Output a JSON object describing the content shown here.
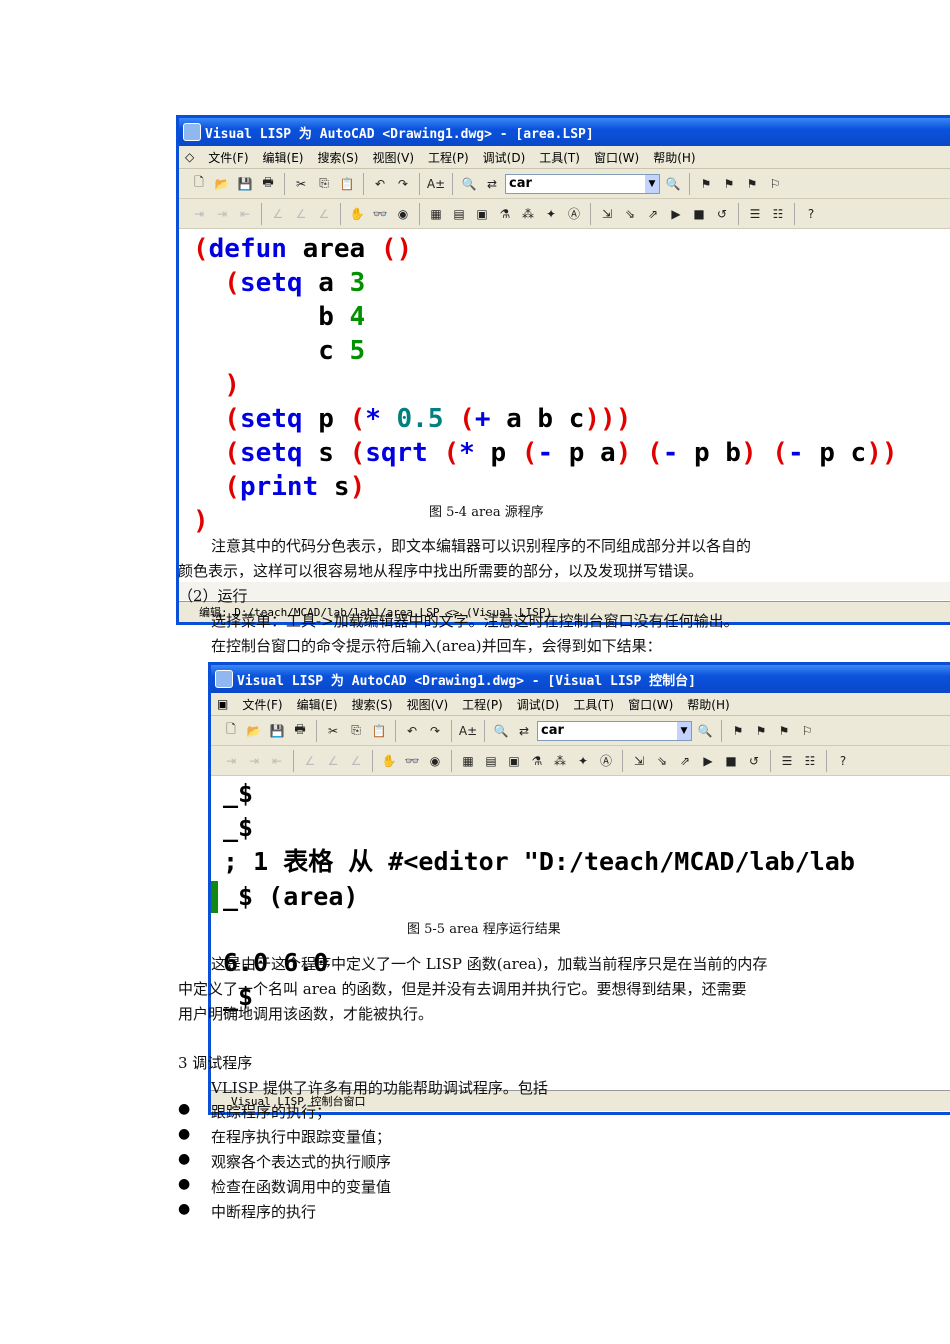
{
  "window1": {
    "title": "Visual LISP 为 AutoCAD <Drawing1.dwg> - [area.LSP]",
    "menu": [
      "文件(F)",
      "编辑(E)",
      "搜索(S)",
      "视图(V)",
      "工程(P)",
      "调试(D)",
      "工具(T)",
      "窗口(W)",
      "帮助(H)"
    ],
    "search_value": "car",
    "code": [
      [
        {
          "t": "(",
          "c": "#e00000"
        },
        {
          "t": "defun",
          "c": "#0000e0"
        },
        {
          "t": " area ",
          "c": "#000"
        },
        {
          "t": "()",
          "c": "#e00000"
        }
      ],
      [
        {
          "t": "  (",
          "c": "#e00000"
        },
        {
          "t": "setq",
          "c": "#0000e0"
        },
        {
          "t": " a ",
          "c": "#000"
        },
        {
          "t": "3",
          "c": "#009000"
        }
      ],
      [
        {
          "t": "        b ",
          "c": "#000"
        },
        {
          "t": "4",
          "c": "#009000"
        }
      ],
      [
        {
          "t": "        c ",
          "c": "#000"
        },
        {
          "t": "5",
          "c": "#009000"
        }
      ],
      [
        {
          "t": "  )",
          "c": "#e00000"
        }
      ],
      [
        {
          "t": "  (",
          "c": "#e00000"
        },
        {
          "t": "setq",
          "c": "#0000e0"
        },
        {
          "t": " p ",
          "c": "#000"
        },
        {
          "t": "(",
          "c": "#e00000"
        },
        {
          "t": "*",
          "c": "#0000e0"
        },
        {
          "t": " ",
          "c": "#000"
        },
        {
          "t": "0.5",
          "c": "#008080"
        },
        {
          "t": " (",
          "c": "#e00000"
        },
        {
          "t": "+",
          "c": "#0000e0"
        },
        {
          "t": " a b c",
          "c": "#000"
        },
        {
          "t": ")))",
          "c": "#e00000"
        }
      ],
      [
        {
          "t": "  (",
          "c": "#e00000"
        },
        {
          "t": "setq",
          "c": "#0000e0"
        },
        {
          "t": " s ",
          "c": "#000"
        },
        {
          "t": "(",
          "c": "#e00000"
        },
        {
          "t": "sqrt",
          "c": "#0000e0"
        },
        {
          "t": " (",
          "c": "#e00000"
        },
        {
          "t": "*",
          "c": "#0000e0"
        },
        {
          "t": " p ",
          "c": "#000"
        },
        {
          "t": "(",
          "c": "#e00000"
        },
        {
          "t": "-",
          "c": "#0000e0"
        },
        {
          "t": " p a",
          "c": "#000"
        },
        {
          "t": ")",
          "c": "#e00000"
        },
        {
          "t": " (",
          "c": "#e00000"
        },
        {
          "t": "-",
          "c": "#0000e0"
        },
        {
          "t": " p b",
          "c": "#000"
        },
        {
          "t": ")",
          "c": "#e00000"
        },
        {
          "t": " (",
          "c": "#e00000"
        },
        {
          "t": "-",
          "c": "#0000e0"
        },
        {
          "t": " p c",
          "c": "#000"
        },
        {
          "t": "))",
          "c": "#e00000"
        }
      ],
      [
        {
          "t": "  (",
          "c": "#e00000"
        },
        {
          "t": "print",
          "c": "#0000e0"
        },
        {
          "t": " s",
          "c": "#000"
        },
        {
          "t": ")",
          "c": "#e00000"
        }
      ],
      [
        {
          "t": ")",
          "c": "#e00000"
        }
      ]
    ],
    "status": "编辑:  D:/teach/MCAD/lab/lab1/area.LSP  <>  (Visual LISP)"
  },
  "window2": {
    "title": "Visual LISP 为 AutoCAD <Drawing1.dwg> - [Visual LISP 控制台]",
    "menu": [
      "文件(F)",
      "编辑(E)",
      "搜索(S)",
      "视图(V)",
      "工程(P)",
      "调试(D)",
      "工具(T)",
      "窗口(W)",
      "帮助(H)"
    ],
    "search_value": "car",
    "console": [
      "_$",
      "_$",
      "; 1 表格 从 #<editor \"D:/teach/MCAD/lab/lab",
      "_$ (area)",
      "",
      "6.0 6.0",
      "_$"
    ],
    "status": "Visual LISP 控制台窗口"
  },
  "doc": {
    "caption1": "图 5-4    area 源程序",
    "p1a": "注意其中的代码分色表示，即文本编辑器可以识别程序的不同组成部分并以各自的",
    "p1b": "颜色表示，这样可以很容易地从程序中找出所需要的部分，以及发现拼写错误。",
    "h2": "（2）运行",
    "p2a": "选择菜单：工具->加载编辑器中的文字。注意这时在控制台窗口没有任何输出。",
    "p2b": "在控制台窗口的命令提示符后输入(area)并回车，会得到如下结果：",
    "caption2": "图 5-5    area 程序运行结果",
    "p3a": "这是由于这个程序中定义了一个 LISP 函数(area)，加载当前程序只是在当前的内存",
    "p3b": "中定义了一个名叫  area  的函数，但是并没有去调用并执行它。要想得到结果，还需要",
    "p3c": "用户明确地调用该函数，才能被执行。",
    "h3": "3  调试程序",
    "p4": "VLISP 提供了许多有用的功能帮助调试程序。包括",
    "bullets": [
      "跟踪程序的执行；",
      "在程序执行中跟踪变量值；",
      "观察各个表达式的执行顺序",
      "检查在函数调用中的变量值",
      "中断程序的执行"
    ]
  }
}
